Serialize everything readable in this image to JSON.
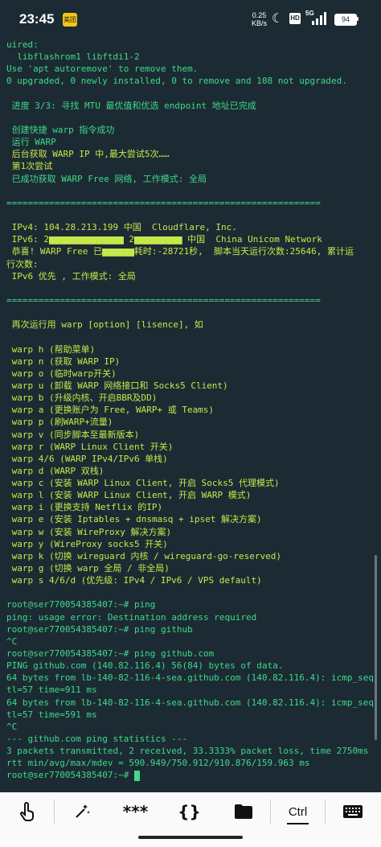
{
  "status_bar": {
    "time": "23:45",
    "app_badge": "美团",
    "net_speed": "0.25",
    "net_unit": "KB/s",
    "hd": "HD",
    "signal": "5G",
    "battery": "94"
  },
  "terminal_lines": [
    {
      "text": "uired:",
      "color": "g"
    },
    {
      "text": "  libflashrom1 libftdi1-2",
      "color": "g"
    },
    {
      "text": "Use 'apt autoremove' to remove them.",
      "color": "g"
    },
    {
      "text": "0 upgraded, 0 newly installed, 0 to remove and 108 not upgraded.",
      "color": "g"
    },
    {
      "text": "",
      "color": "g"
    },
    {
      "text": " 进度 3/3: 寻找 MTU 最优值和优选 endpoint 地址已完成",
      "color": "g"
    },
    {
      "text": "",
      "color": "g"
    },
    {
      "text": " 创建快捷 warp 指令成功",
      "color": "g"
    },
    {
      "text": " 运行 WARP",
      "color": "g"
    },
    {
      "text": " 后台获取 WARP IP 中,最大尝试5次……",
      "color": "y"
    },
    {
      "text": " 第1次尝试",
      "color": "y"
    },
    {
      "text": " 已成功获取 WARP Free 网络, 工作模式: 全局",
      "color": "g"
    },
    {
      "text": "",
      "color": "g"
    },
    {
      "text": "===========================================================",
      "color": "g"
    },
    {
      "text": "",
      "color": "g"
    },
    {
      "text": " IPv4: 104.28.213.199 中国  Cloudflare, Inc.",
      "color": "y"
    },
    {
      "text": " IPv6: 2▆▆▆▆▆▆▆▆▆▆▆▆▆▆ 2▆▆▆▆▆▆▆▆▆ 中国  China Unicom Network",
      "color": "y"
    },
    {
      "text": " 恭喜! WARP Free 已▆▆▆▆▆▆耗时:-28721秒,  脚本当天运行次数:25646, 累计运",
      "color": "y"
    },
    {
      "text": "行次数:",
      "color": "y"
    },
    {
      "text": " IPv6 优先 , 工作模式: 全局",
      "color": "y"
    },
    {
      "text": "",
      "color": "g"
    },
    {
      "text": "===========================================================",
      "color": "g"
    },
    {
      "text": "",
      "color": "g"
    },
    {
      "text": " 再次运行用 warp [option] [lisence], 如",
      "color": "y"
    },
    {
      "text": "",
      "color": "g"
    },
    {
      "text": " warp h (帮助菜单)",
      "color": "y"
    },
    {
      "text": " warp n (获取 WARP IP)",
      "color": "y"
    },
    {
      "text": " warp o (临时warp开关)",
      "color": "y"
    },
    {
      "text": " warp u (卸载 WARP 网络接口和 Socks5 Client)",
      "color": "y"
    },
    {
      "text": " warp b (升级内核、开启BBR及DD)",
      "color": "y"
    },
    {
      "text": " warp a (更换账户为 Free, WARP+ 或 Teams)",
      "color": "y"
    },
    {
      "text": " warp p (刷WARP+流量)",
      "color": "y"
    },
    {
      "text": " warp v (同步脚本至最新版本)",
      "color": "y"
    },
    {
      "text": " warp r (WARP Linux Client 开关)",
      "color": "y"
    },
    {
      "text": " warp 4/6 (WARP IPv4/IPv6 单栈)",
      "color": "y"
    },
    {
      "text": " warp d (WARP 双栈)",
      "color": "y"
    },
    {
      "text": " warp c (安装 WARP Linux Client, 开启 Socks5 代理模式)",
      "color": "y"
    },
    {
      "text": " warp l (安装 WARP Linux Client, 开启 WARP 模式)",
      "color": "y"
    },
    {
      "text": " warp i (更换支持 Netflix 的IP)",
      "color": "y"
    },
    {
      "text": " warp e (安装 Iptables + dnsmasq + ipset 解决方案)",
      "color": "y"
    },
    {
      "text": " warp w (安装 WireProxy 解决方案)",
      "color": "y"
    },
    {
      "text": " warp y (WireProxy socks5 开关)",
      "color": "y"
    },
    {
      "text": " warp k (切换 wireguard 内核 / wireguard-go-reserved)",
      "color": "y"
    },
    {
      "text": " warp g (切换 warp 全局 / 非全局)",
      "color": "y"
    },
    {
      "text": " warp s 4/6/d (优先级: IPv4 / IPv6 / VPS default)",
      "color": "y"
    },
    {
      "text": "",
      "color": "g"
    },
    {
      "text": "root@ser770054385407:~# ping",
      "color": "g"
    },
    {
      "text": "ping: usage error: Destination address required",
      "color": "g"
    },
    {
      "text": "root@ser770054385407:~# ping github",
      "color": "g"
    },
    {
      "text": "^C",
      "color": "g"
    },
    {
      "text": "root@ser770054385407:~# ping github.com",
      "color": "g"
    },
    {
      "text": "PING github.com (140.82.116.4) 56(84) bytes of data.",
      "color": "g"
    },
    {
      "text": "64 bytes from lb-140-82-116-4-sea.github.com (140.82.116.4): icmp_seq=1 t",
      "color": "g"
    },
    {
      "text": "tl=57 time=911 ms",
      "color": "g"
    },
    {
      "text": "64 bytes from lb-140-82-116-4-sea.github.com (140.82.116.4): icmp_seq=2 t",
      "color": "g"
    },
    {
      "text": "tl=57 time=591 ms",
      "color": "g"
    },
    {
      "text": "^C",
      "color": "g"
    },
    {
      "text": "--- github.com ping statistics ---",
      "color": "g"
    },
    {
      "text": "3 packets transmitted, 2 received, 33.3333% packet loss, time 2750ms",
      "color": "g"
    },
    {
      "text": "rtt min/avg/max/mdev = 590.949/750.912/910.876/159.963 ms",
      "color": "g"
    },
    {
      "text": "root@ser770054385407:~# ",
      "color": "g"
    }
  ],
  "toolbar": {
    "touch_icon": "touch-icon",
    "magic_icon": "magic-wand-icon",
    "password_label": "***",
    "braces_label": "{}",
    "folder_icon": "folder-icon",
    "ctrl_label": "Ctrl",
    "keyboard_icon": "keyboard-icon"
  },
  "colors": {
    "background": "#1c2b33",
    "green_text": "#3fd98a",
    "yellow_text": "#c6e84a"
  }
}
